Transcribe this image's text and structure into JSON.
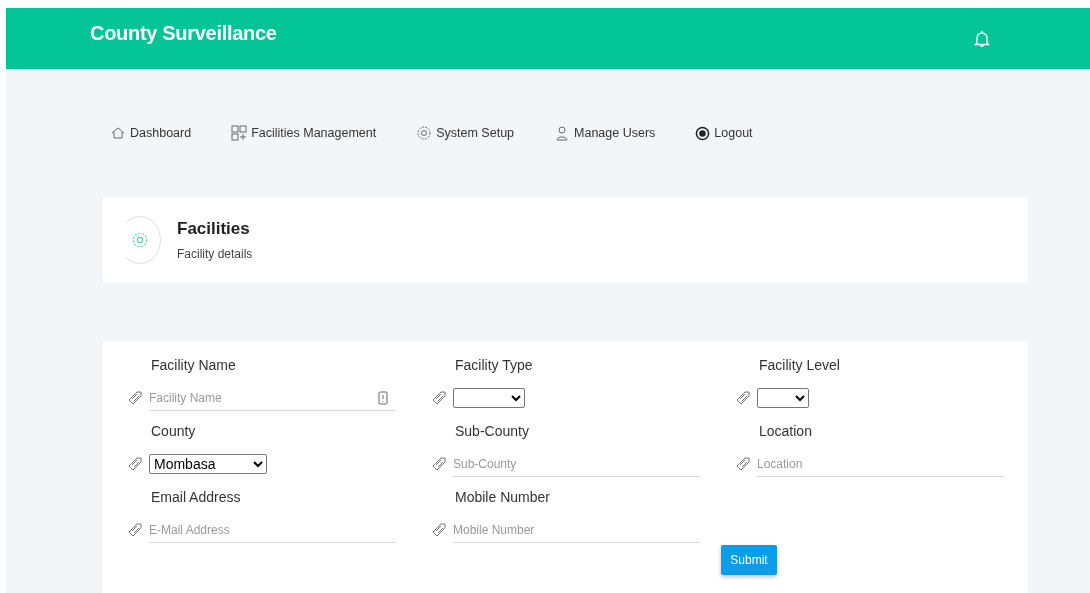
{
  "header": {
    "title": "County Surveillance"
  },
  "nav": [
    {
      "label": "Dashboard"
    },
    {
      "label": "Facilities Management"
    },
    {
      "label": "System Setup"
    },
    {
      "label": "Manage Users"
    },
    {
      "label": "Logout"
    }
  ],
  "page_heading": {
    "title": "Facilities",
    "subtitle": "Facility details"
  },
  "form": {
    "fields": [
      {
        "kind": "text",
        "label": "Facility Name",
        "placeholder": "Facility Name",
        "trailing_icon": true
      },
      {
        "kind": "select",
        "label": "Facility Type"
      },
      {
        "kind": "select",
        "label": "Facility Level"
      },
      {
        "kind": "select",
        "label": "County",
        "value": "Mombasa"
      },
      {
        "kind": "text",
        "label": "Sub-County",
        "placeholder": "Sub-County"
      },
      {
        "kind": "text",
        "label": "Location",
        "placeholder": "Location"
      },
      {
        "kind": "text",
        "label": "Email Address",
        "placeholder": "E-Mail Address"
      },
      {
        "kind": "text",
        "label": "Mobile Number",
        "placeholder": "Mobile Number"
      },
      {
        "kind": "button",
        "label": "Submit"
      }
    ]
  }
}
